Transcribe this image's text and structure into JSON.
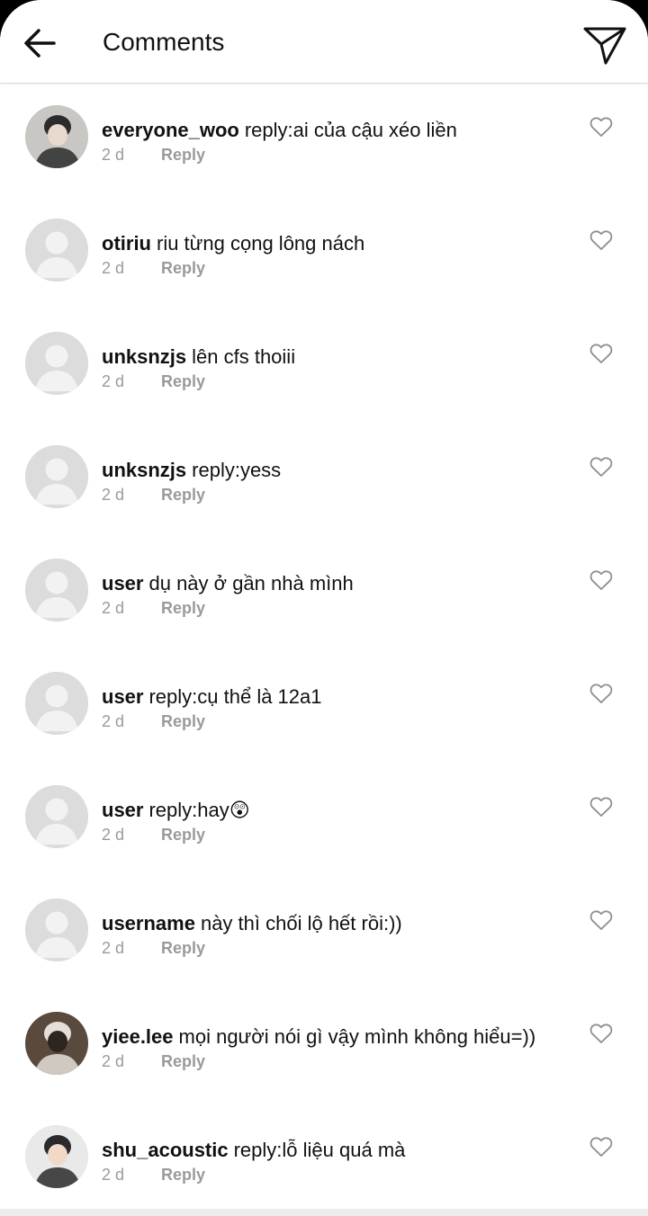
{
  "header": {
    "title": "Comments",
    "back_icon": "arrow-left-icon",
    "send_icon": "paper-plane-icon"
  },
  "colors": {
    "text": "#111111",
    "muted": "#9a9a9a",
    "placeholder_avatar": "#dcdcdc"
  },
  "comments": [
    {
      "username": "everyone_woo",
      "text": "reply:ai của cậu xéo liền",
      "time": "2 d",
      "reply": "Reply",
      "avatar": "photo"
    },
    {
      "username": "otiriu",
      "text": "riu từng cọng lông nách",
      "time": "2 d",
      "reply": "Reply",
      "avatar": "default"
    },
    {
      "username": "unksnzjs",
      "text": "lên cfs thoiii",
      "time": "2 d",
      "reply": "Reply",
      "avatar": "default"
    },
    {
      "username": "unksnzjs",
      "text": "reply:yess",
      "time": "2 d",
      "reply": "Reply",
      "avatar": "default"
    },
    {
      "username": "user",
      "text": "dụ này ở gần nhà mình",
      "time": "2 d",
      "reply": "Reply",
      "avatar": "default"
    },
    {
      "username": "user",
      "text": "reply:cụ thể là 12a1",
      "time": "2 d",
      "reply": "Reply",
      "avatar": "default"
    },
    {
      "username": "user",
      "text": "reply:hay😲",
      "time": "2 d",
      "reply": "Reply",
      "avatar": "default"
    },
    {
      "username": "username",
      "text": "này thì chối lộ hết rồi:))",
      "time": "2 d",
      "reply": "Reply",
      "avatar": "default"
    },
    {
      "username": "yiee.lee",
      "text": "mọi người nói gì vậy mình không hiểu=))",
      "time": "2 d",
      "reply": "Reply",
      "avatar": "photo"
    },
    {
      "username": "shu_acoustic",
      "text": "reply:lỗ liệu quá mà",
      "time": "2 d",
      "reply": "Reply",
      "avatar": "photo"
    }
  ]
}
